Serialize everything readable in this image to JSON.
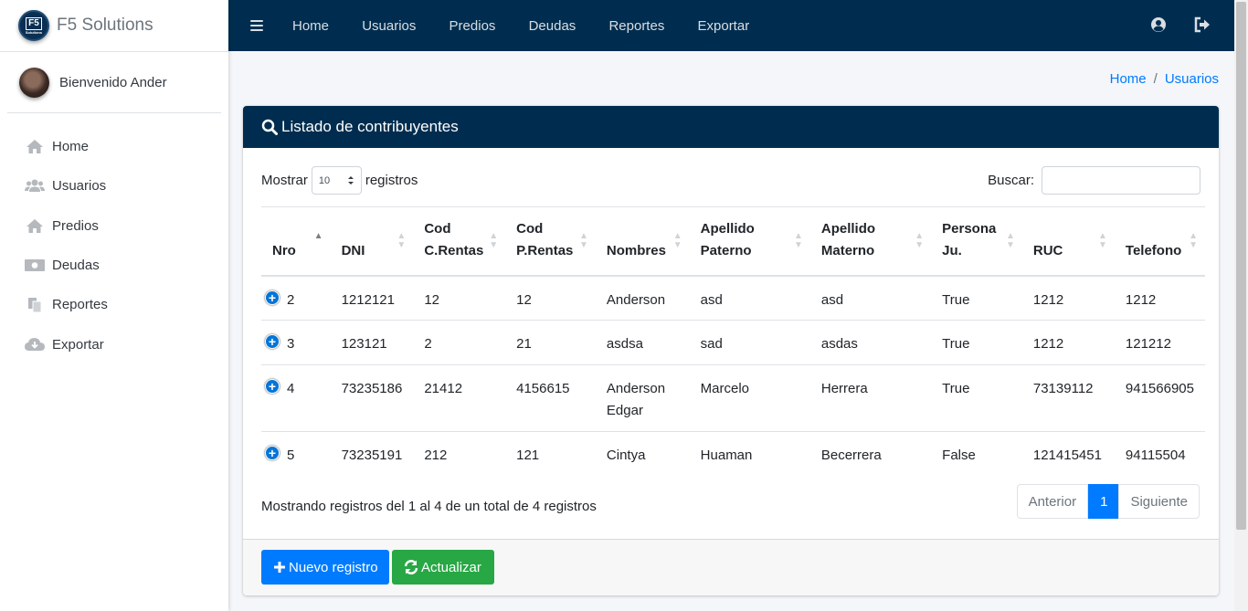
{
  "brand": {
    "name": "F5 Solutions",
    "logo_text": "F5",
    "logo_sub": "Solutions"
  },
  "user": {
    "greeting": "Bienvenido Ander"
  },
  "sidebar": {
    "items": [
      {
        "label": "Home",
        "icon": "home-icon"
      },
      {
        "label": "Usuarios",
        "icon": "users-icon"
      },
      {
        "label": "Predios",
        "icon": "home-icon"
      },
      {
        "label": "Deudas",
        "icon": "money-bill-icon"
      },
      {
        "label": "Reportes",
        "icon": "copy-icon"
      },
      {
        "label": "Exportar",
        "icon": "cloud-download-icon"
      }
    ]
  },
  "topnav": {
    "items": [
      "Home",
      "Usuarios",
      "Predios",
      "Deudas",
      "Reportes",
      "Exportar"
    ],
    "right_icons": [
      "user-circle-icon",
      "sign-out-icon"
    ]
  },
  "breadcrumb": {
    "home": "Home",
    "separator": "/",
    "current": "Usuarios"
  },
  "card": {
    "title": "Listado de contribuyentes",
    "length": {
      "prefix": "Mostrar",
      "value": "10",
      "suffix": "registros"
    },
    "search": {
      "label": "Buscar:",
      "value": ""
    },
    "columns": [
      {
        "line1": "",
        "line2": "Nro"
      },
      {
        "line1": "",
        "line2": "DNI"
      },
      {
        "line1": "Cod",
        "line2": "C.Rentas"
      },
      {
        "line1": "Cod",
        "line2": "P.Rentas"
      },
      {
        "line1": "",
        "line2": "Nombres"
      },
      {
        "line1": "Apellido",
        "line2": "Paterno"
      },
      {
        "line1": "Apellido",
        "line2": "Materno"
      },
      {
        "line1": "Persona",
        "line2": "Ju."
      },
      {
        "line1": "",
        "line2": "RUC"
      },
      {
        "line1": "",
        "line2": "Telefono"
      }
    ],
    "rows": [
      [
        "2",
        "1212121",
        "12",
        "12",
        "Anderson",
        "asd",
        "asd",
        "True",
        "1212",
        "1212"
      ],
      [
        "3",
        "123121",
        "2",
        "21",
        "asdsa",
        "sad",
        "asdas",
        "True",
        "1212",
        "121212"
      ],
      [
        "4",
        "73235186",
        "21412",
        "4156615",
        "Anderson Edgar",
        "Marcelo",
        "Herrera",
        "True",
        "73139112",
        "941566905"
      ],
      [
        "5",
        "73235191",
        "212",
        "121",
        "Cintya",
        "Huaman",
        "Becerrera",
        "False",
        "121415451",
        "94115504"
      ]
    ],
    "info": "Mostrando registros del 1 al 4 de un total de 4 registros",
    "pager": {
      "prev": "Anterior",
      "current": "1",
      "next": "Siguiente"
    },
    "buttons": {
      "new": "Nuevo registro",
      "refresh": "Actualizar"
    }
  },
  "colors": {
    "navbar": "#002d4f",
    "primary": "#007bff",
    "success": "#28a745"
  }
}
